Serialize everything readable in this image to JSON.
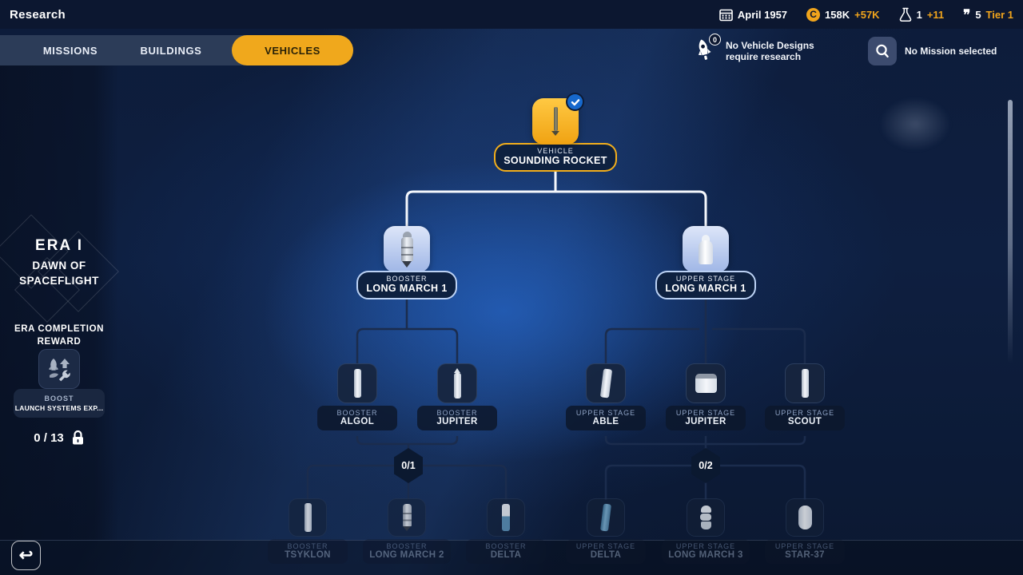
{
  "header": {
    "title": "Research",
    "stats": {
      "date": "April 1957",
      "date_icon": "calendar-icon",
      "funds": "158K",
      "funds_delta": "+57K",
      "funds_icon": "coin-icon",
      "science": "1",
      "science_delta": "+11",
      "science_icon": "flask-icon",
      "support": "5",
      "support_tier": "Tier 1",
      "support_icon": "quotes-icon"
    }
  },
  "tabs": [
    {
      "label": "MISSIONS",
      "active": false
    },
    {
      "label": "BUILDINGS",
      "active": false
    },
    {
      "label": "VEHICLES",
      "active": true
    }
  ],
  "notices": {
    "vehicle_badge": "0",
    "vehicle_icon": "rocket-icon",
    "vehicle_line1": "No Vehicle Designs",
    "vehicle_line2": "require research",
    "mission_icon": "magnifier-icon",
    "mission_text": "No Mission selected"
  },
  "sidebar": {
    "era_title": "ERA I",
    "era_sub_line1": "DAWN OF",
    "era_sub_line2": "SPACEFLIGHT",
    "reward_head_line1": "ERA COMPLETION",
    "reward_head_line2": "REWARD",
    "reward_icon": "boost-launch-systems-icon",
    "reward_type": "BOOST",
    "reward_name": "LAUNCH SYSTEMS EXP...",
    "progress": "0 / 13",
    "progress_icon": "lock-icon"
  },
  "tree": {
    "root": {
      "category": "VEHICLE",
      "name": "SOUNDING ROCKET",
      "state": "researched",
      "icon": "sounding-rocket-icon"
    },
    "tier2": [
      {
        "category": "BOOSTER",
        "name": "LONG MARCH 1",
        "state": "available",
        "icon": "booster-icon"
      },
      {
        "category": "UPPER STAGE",
        "name": "LONG MARCH 1",
        "state": "available",
        "icon": "upper-stage-icon"
      }
    ],
    "tier3": [
      {
        "category": "BOOSTER",
        "name": "ALGOL",
        "state": "locked",
        "icon": "booster-icon"
      },
      {
        "category": "BOOSTER",
        "name": "JUPITER",
        "state": "locked",
        "icon": "booster-icon"
      },
      {
        "category": "UPPER STAGE",
        "name": "ABLE",
        "state": "locked",
        "icon": "upper-stage-icon"
      },
      {
        "category": "UPPER STAGE",
        "name": "JUPITER",
        "state": "locked",
        "icon": "upper-stage-icon"
      },
      {
        "category": "UPPER STAGE",
        "name": "SCOUT",
        "state": "locked",
        "icon": "upper-stage-icon"
      }
    ],
    "counters": [
      {
        "value": "0/1"
      },
      {
        "value": "0/2"
      }
    ],
    "tier4": [
      {
        "category": "BOOSTER",
        "name": "TSYKLON",
        "state": "hidden",
        "icon": "booster-icon"
      },
      {
        "category": "BOOSTER",
        "name": "LONG MARCH 2",
        "state": "hidden",
        "icon": "booster-icon"
      },
      {
        "category": "BOOSTER",
        "name": "DELTA",
        "state": "hidden",
        "icon": "booster-icon"
      },
      {
        "category": "UPPER STAGE",
        "name": "DELTA",
        "state": "hidden",
        "icon": "upper-stage-icon"
      },
      {
        "category": "UPPER STAGE",
        "name": "LONG MARCH 3",
        "state": "hidden",
        "icon": "upper-stage-icon"
      },
      {
        "category": "UPPER STAGE",
        "name": "STAR-37",
        "state": "hidden",
        "icon": "upper-stage-icon"
      }
    ]
  },
  "footer": {
    "back_icon": "back-arrow-icon",
    "back_glyph": "↩"
  },
  "colors": {
    "accent_orange": "#f0a81c",
    "accent_blue": "#1668cc",
    "tile_available": "#b9cdf0",
    "background_navy": "#0d1c3a"
  }
}
